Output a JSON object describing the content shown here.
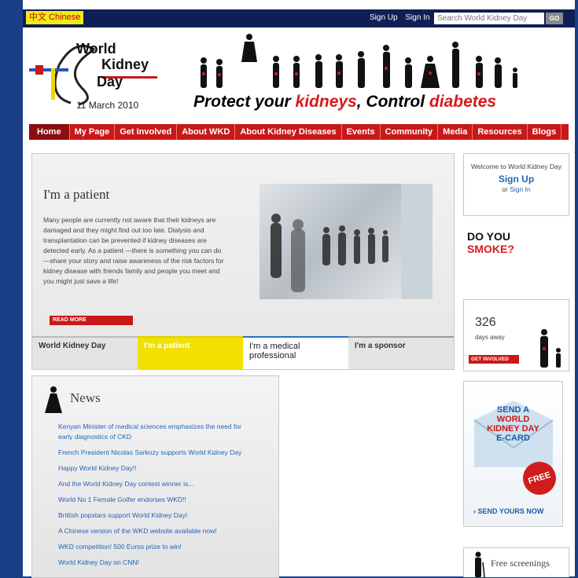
{
  "topbar": {
    "language": "中文  Chinese",
    "signup": "Sign Up",
    "signin": "Sign In",
    "search_placeholder": "Search World Kidney Day",
    "go": "GO"
  },
  "logo": {
    "line1": "World",
    "line2": "Kidney",
    "line3": "Day",
    "date": "11 March 2010"
  },
  "banner": {
    "part1": "Protect your ",
    "part2": "kidneys",
    "part3": ", Control ",
    "part4": "diabetes"
  },
  "nav": [
    "Home",
    "My Page",
    "Get Involved",
    "About WKD",
    "About Kidney Diseases",
    "Events",
    "Community",
    "Media",
    "Resources",
    "Blogs"
  ],
  "feature": {
    "title": "I'm a patient",
    "body": "Many people are currently not aware that their kidneys are damaged and they might find out too late. Dialysis and transplantation can be prevented if kidney diseases are detected early. As a patient —there is something you can do—share your story and raise awareness of the risk factors for kidney disease with friends family and people you meet and you might just save a life!",
    "read_more": "READ MORE",
    "tabs": [
      "World Kidney Day",
      "I'm a patient",
      "I'm a medical professional",
      "I'm a sponsor"
    ]
  },
  "news": {
    "title": "News",
    "items": [
      "Kenyan Minister of medical sciences emphasizes the need for early diagnostics of CKD",
      "French President Nicolas Sarkozy supports World Kidney Day",
      "Happy World Kidney Day!!",
      "And the World Kidney Day contest winner is...",
      "World No 1 Female Golfer endorses WKD!!",
      "Brittish popstars support World Kidney Day!",
      "A Chinese version of the WKD website available now!",
      "WKD competition! 500 Euros prize to win!",
      "World Kidney Day on CNN!"
    ]
  },
  "sidebar": {
    "welcome": "Welcome to World Kidney Day",
    "signup": "Sign Up",
    "or": "or",
    "signin": "Sign In",
    "smoke_1": "DO YOU",
    "smoke_2": "SMOKE?",
    "days": "326",
    "days_label": "days away",
    "get_involved": "GET INVOLVED",
    "ecard_1": "SEND A",
    "ecard_2": "WORLD",
    "ecard_3": "KIDNEY DAY",
    "ecard_4": "E-CARD",
    "free": "FREE",
    "send_yours": "› SEND YOURS NOW",
    "screenings": "Free screenings"
  },
  "colors": {
    "brand_red": "#c91818",
    "dark_navy": "#0f1f55",
    "link_blue": "#2166b6",
    "accent_yellow": "#f2e000"
  }
}
